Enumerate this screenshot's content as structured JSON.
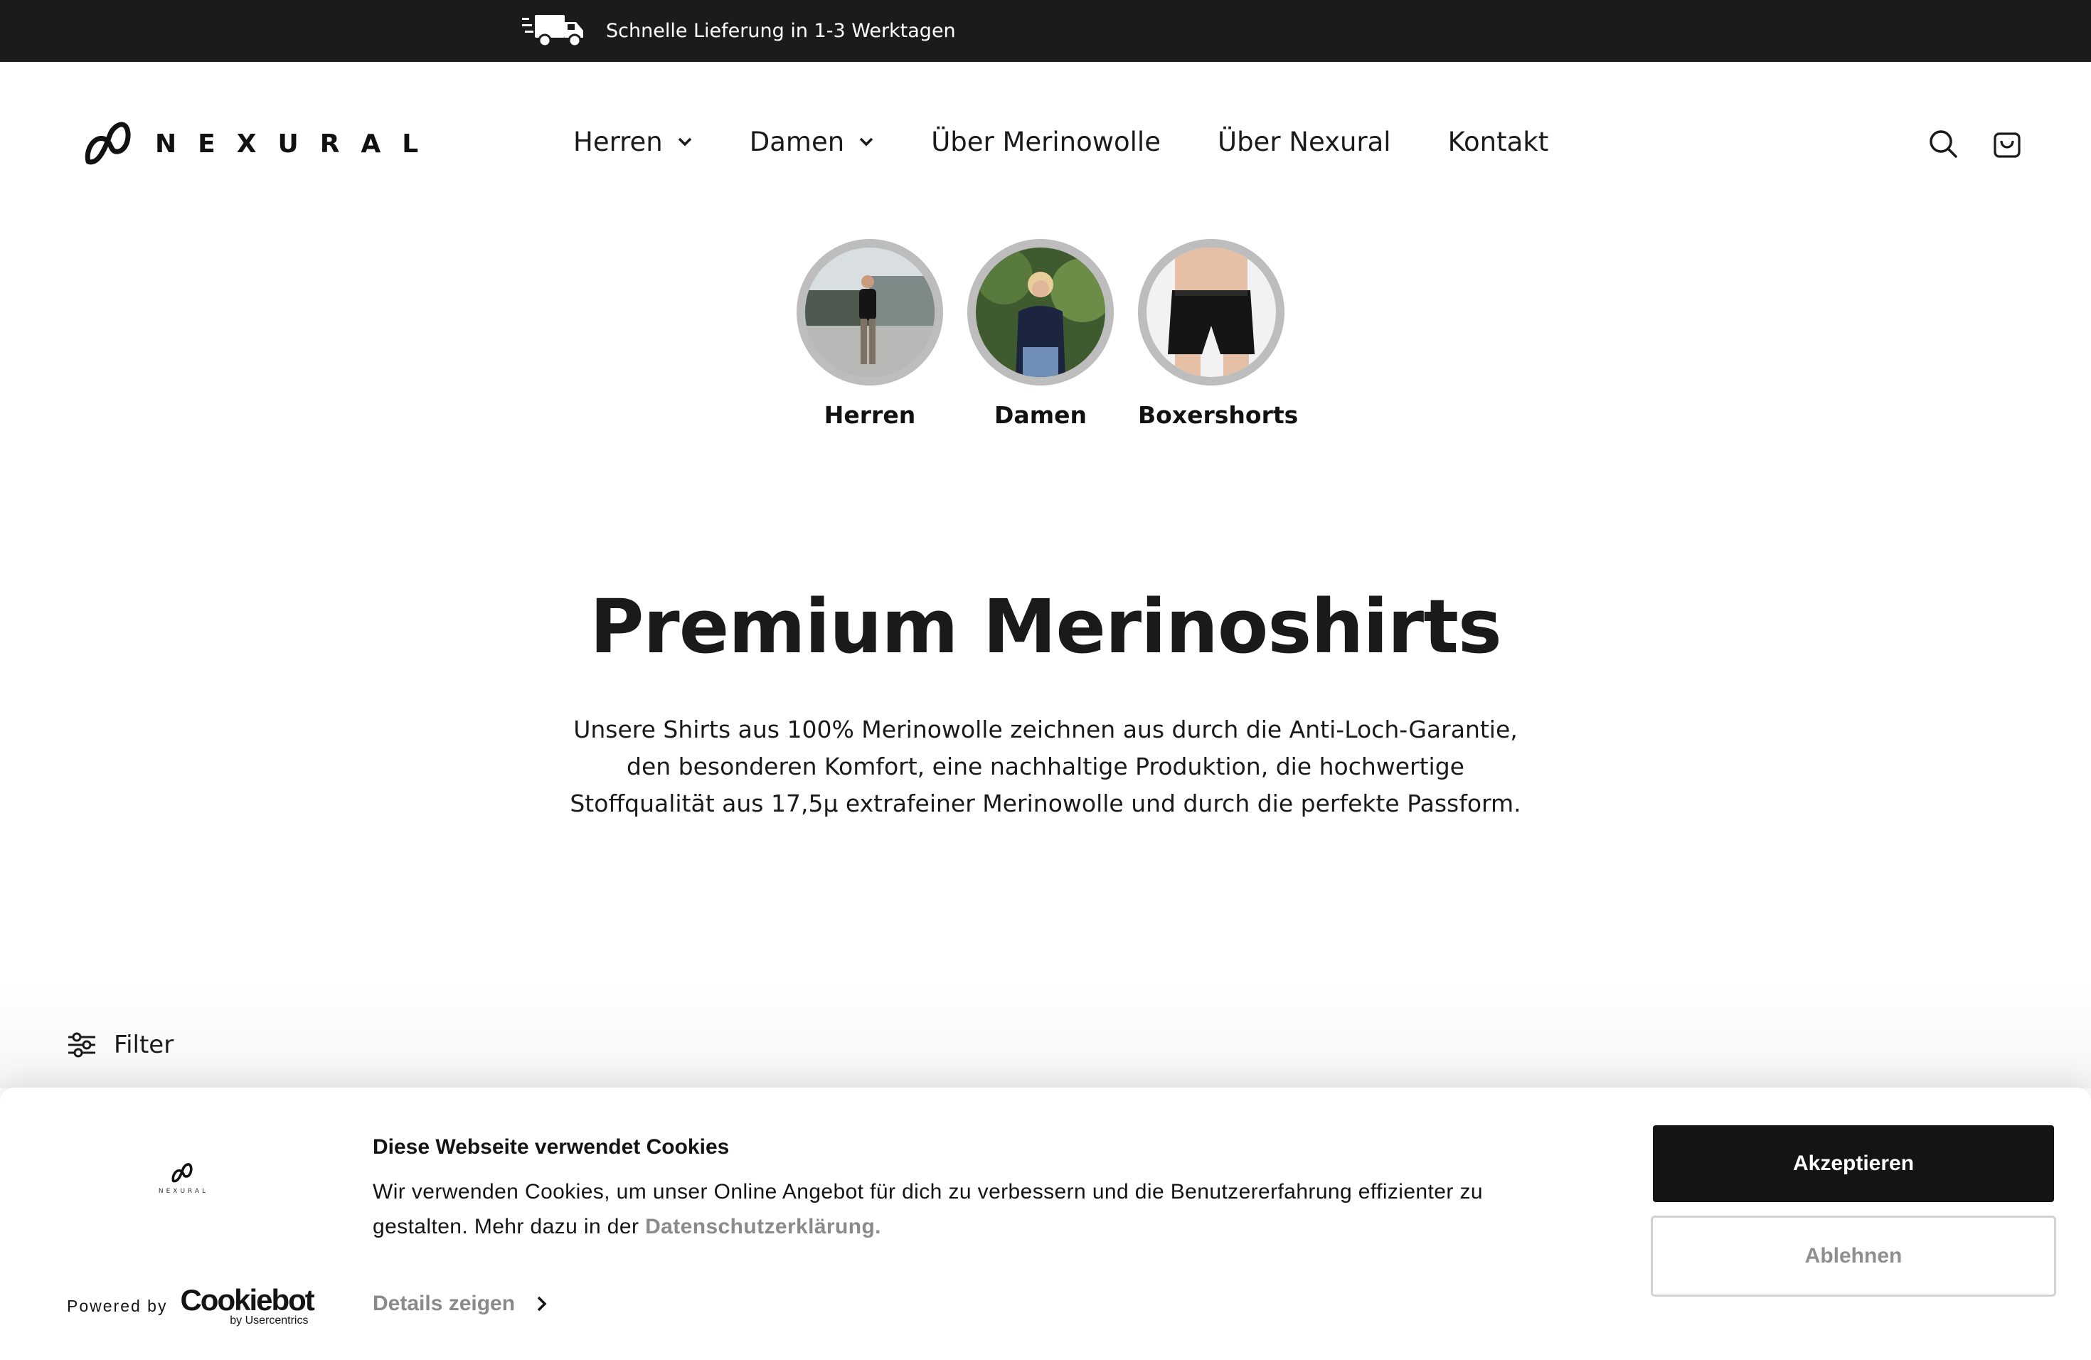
{
  "announcement": {
    "icon": "delivery-truck-icon",
    "text": "Schnelle Lieferung in 1-3 Werktagen"
  },
  "header": {
    "logo_text": "NEXURAL",
    "nav": [
      {
        "label": "Herren",
        "has_dropdown": true
      },
      {
        "label": "Damen",
        "has_dropdown": true
      },
      {
        "label": "Über Merinowolle",
        "has_dropdown": false
      },
      {
        "label": "Über Nexural",
        "has_dropdown": false
      },
      {
        "label": "Kontakt",
        "has_dropdown": false
      }
    ],
    "icons": [
      "search-icon",
      "cart-icon"
    ]
  },
  "categories": [
    {
      "label": "Herren"
    },
    {
      "label": "Damen"
    },
    {
      "label": "Boxershorts"
    }
  ],
  "hero": {
    "title": "Premium Merinoshirts",
    "lines": [
      "Unsere Shirts aus 100% Merinowolle zeichnen aus durch die Anti-Loch-Garantie,",
      "den besonderen Komfort, eine nachhaltige Produktion, die hochwertige",
      "Stoffqualität aus 17,5µ extrafeiner Merinowolle und durch die perfekte Passform."
    ]
  },
  "filter": {
    "label": "Filter"
  },
  "cookie_banner": {
    "logo_text": "NEXURAL",
    "powered_by": "Powered by",
    "provider": "Cookiebot",
    "provider_sub": "by Usercentrics",
    "title": "Diese Webseite verwendet Cookies",
    "body": "Wir verwenden Cookies, um unser Online Angebot für dich zu verbessern und die Benutzererfahrung effizienter zu gestalten. Mehr dazu in der",
    "link": "Datenschutzerklärung.",
    "details": "Details zeigen",
    "accept": "Akzeptieren",
    "decline": "Ablehnen"
  },
  "colors": {
    "topbar": "#1b1b1b",
    "text": "#1a1a1a",
    "muted": "#8a8a8a",
    "ring": "#bdbdbd"
  }
}
